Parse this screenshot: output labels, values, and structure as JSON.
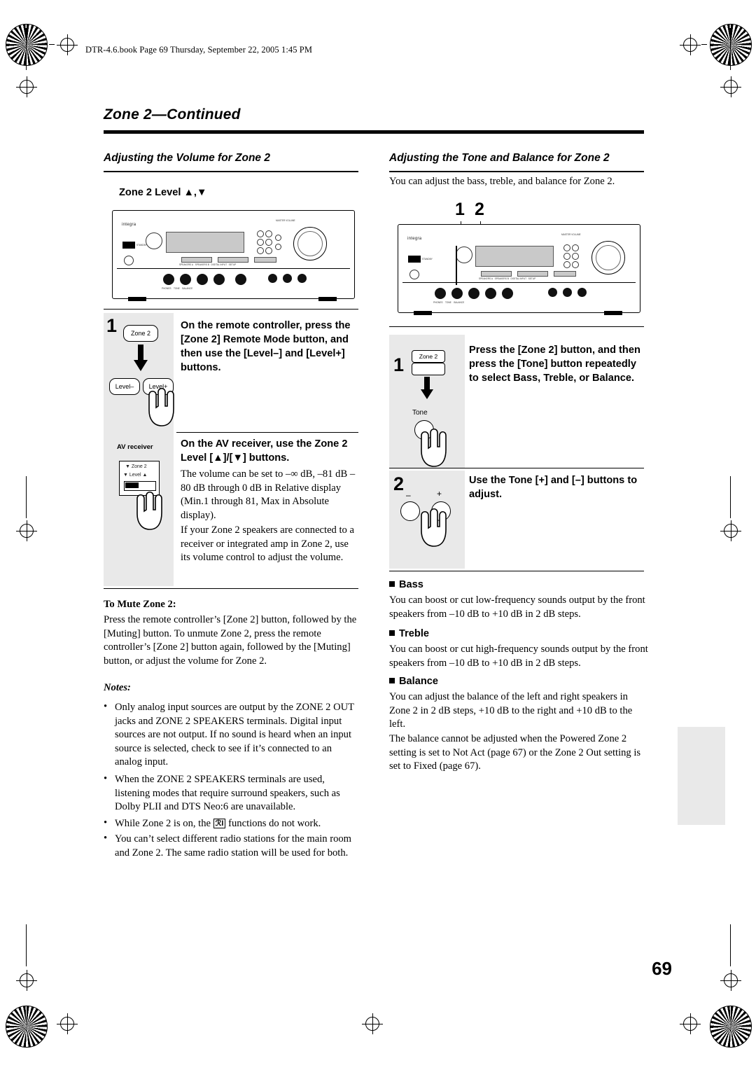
{
  "header": {
    "file_line": "DTR-4.6.book  Page 69  Thursday, September 22, 2005  1:45 PM"
  },
  "chapter": {
    "title": "Zone 2—Continued"
  },
  "page_number": "69",
  "left_column": {
    "section_title": "Adjusting the Volume for Zone 2",
    "figure_caption": "Zone 2 Level ▲,▼",
    "receiver_brand": "integra",
    "step1": {
      "number": "1",
      "text": "On the remote controller, press the [Zone 2] Remote Mode button, and then use the [Level–] and [Level+] buttons.",
      "key_zone2": "Zone 2",
      "key_level_minus": "Level–",
      "key_level_plus": "Level+"
    },
    "step2": {
      "heading": "On the AV receiver, use the Zone 2 Level [▲]/[▼] buttons.",
      "device_label": "AV receiver",
      "device_key_top": "▼  Zone 2",
      "device_key_bottom": "▼  Level  ▲",
      "para1": "The volume can be set to –∞ dB, –81 dB –80 dB through 0 dB in Relative display (Min.1 through 81, Max in Absolute display).",
      "para2": "If your Zone 2 speakers are connected to a receiver or integrated amp in Zone 2, use its volume control to adjust the volume."
    },
    "mute": {
      "heading": "To Mute Zone 2:",
      "text": "Press the remote controller’s [Zone 2] button, followed by the [Muting] button. To unmute Zone 2, press the remote controller’s [Zone 2] button again, followed by the [Muting] button, or adjust the volume for Zone 2."
    },
    "notes": {
      "heading": "Notes:",
      "items": [
        "Only analog input sources are output by the ZONE 2 OUT jacks and ZONE 2 SPEAKERS terminals. Digital input sources are not output. If no sound is heard when an input source is selected, check to see if it’s connected to an analog input.",
        "When the ZONE 2 SPEAKERS terminals are used, listening modes that require surround speakers, such as Dolby PLII and DTS Neo:6 are unavailable.",
        "While Zone 2 is on, the ℞ functions do not work.",
        "You can’t select different radio stations for the main room and Zone 2. The same radio station will be used for both."
      ]
    }
  },
  "right_column": {
    "section_title": "Adjusting the Tone and Balance for Zone 2",
    "intro": "You can adjust the bass, treble, and balance for Zone 2.",
    "callouts": [
      "1",
      "2"
    ],
    "receiver_brand": "integra",
    "step1": {
      "number": "1",
      "text": "Press the [Zone 2] button, and then press the [Tone] button repeatedly to select Bass, Treble, or Balance.",
      "key_zone2": "Zone 2",
      "key_tone": "Tone"
    },
    "step2": {
      "number": "2",
      "text": "Use the Tone [+] and [–] buttons to adjust.",
      "key_minus": "–",
      "key_plus": "+"
    },
    "bass": {
      "heading": "Bass",
      "text": "You can boost or cut low-frequency sounds output by the front speakers from –10 dB to +10 dB in 2 dB steps."
    },
    "treble": {
      "heading": "Treble",
      "text": "You can boost or cut high-frequency sounds output by the front speakers from –10 dB to +10 dB in 2 dB steps."
    },
    "balance": {
      "heading": "Balance",
      "text1": "You can adjust the balance of the left and right speakers in Zone 2 in 2 dB steps, +10 dB to the right and +10 dB to the left.",
      "text2": "The balance cannot be adjusted when the Powered Zone 2 setting is set to Not Act (page 67) or the Zone 2 Out setting is set to Fixed (page 67)."
    }
  }
}
